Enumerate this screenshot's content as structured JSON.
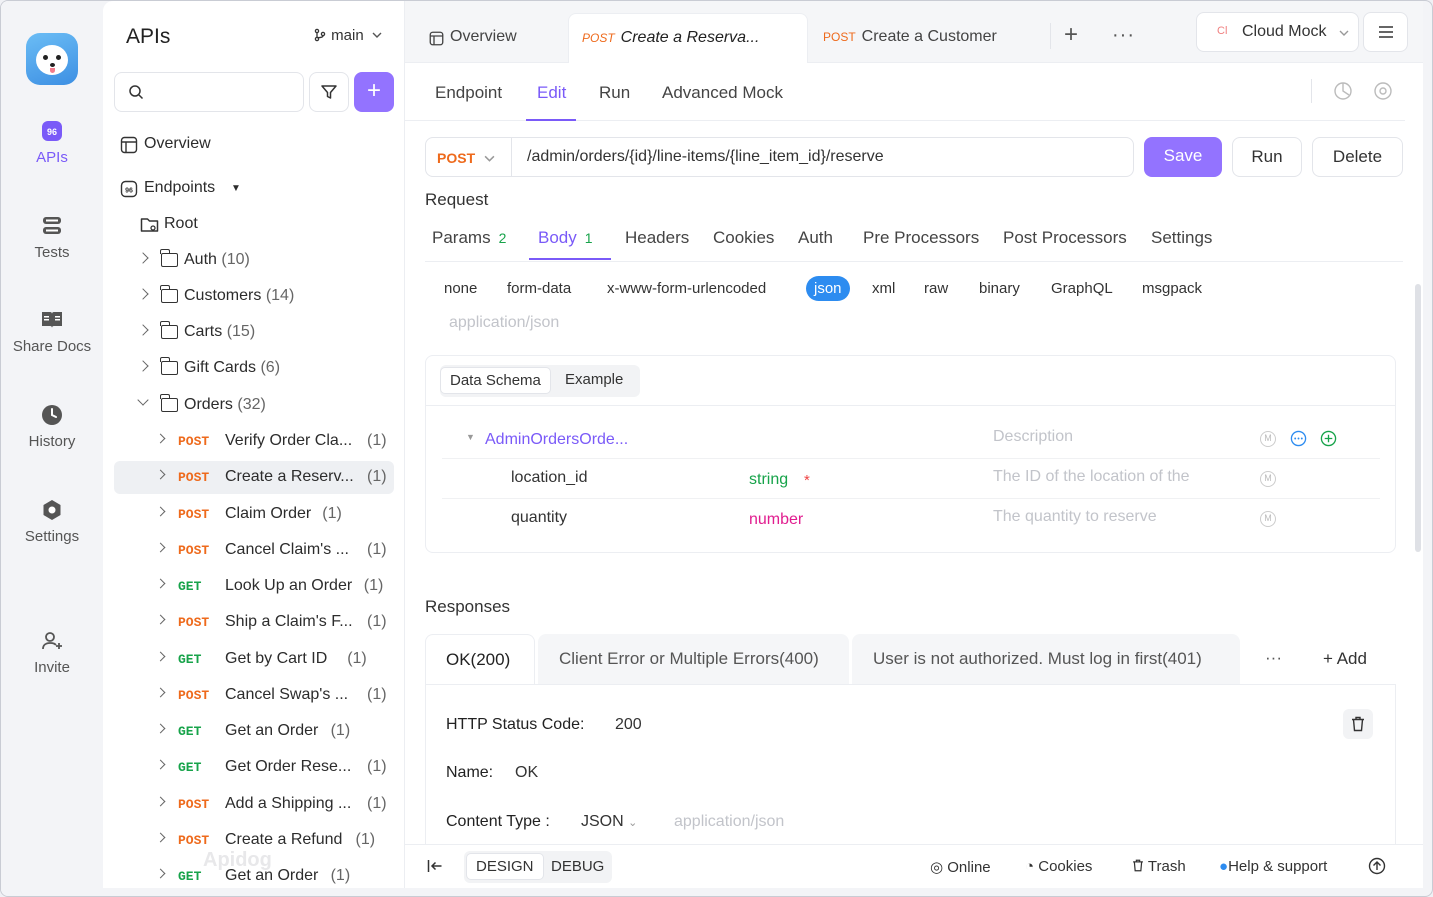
{
  "rail": {
    "items": [
      {
        "label": "APIs",
        "icon": "apis-icon"
      },
      {
        "label": "Tests",
        "icon": "tests-icon"
      },
      {
        "label": "Share Docs",
        "icon": "share-docs-icon"
      },
      {
        "label": "History",
        "icon": "history-icon"
      },
      {
        "label": "Settings",
        "icon": "settings-icon"
      },
      {
        "label": "Invite",
        "icon": "invite-icon"
      }
    ]
  },
  "sidebar": {
    "title": "APIs",
    "branch": "main",
    "overview": "Overview",
    "endpoints": "Endpoints",
    "root": "Root",
    "folders": [
      {
        "name": "Auth",
        "count": "(10)"
      },
      {
        "name": "Customers",
        "count": "(14)"
      },
      {
        "name": "Carts",
        "count": "(15)"
      },
      {
        "name": "Gift Cards",
        "count": "(6)"
      },
      {
        "name": "Orders",
        "count": "(32)"
      }
    ],
    "endpoints_list": [
      {
        "method": "POST",
        "name": "Verify Order Cla...",
        "count": "(1)"
      },
      {
        "method": "POST",
        "name": "Create a Reserv...",
        "count": "(1)"
      },
      {
        "method": "POST",
        "name": "Claim Order",
        "count": "(1)"
      },
      {
        "method": "POST",
        "name": "Cancel Claim's ...",
        "count": "(1)"
      },
      {
        "method": "GET",
        "name": "Look Up an Order",
        "count": "(1)"
      },
      {
        "method": "POST",
        "name": "Ship a Claim's F...",
        "count": "(1)"
      },
      {
        "method": "GET",
        "name": "Get by Cart ID",
        "count": "(1)"
      },
      {
        "method": "POST",
        "name": "Cancel Swap's ...",
        "count": "(1)"
      },
      {
        "method": "GET",
        "name": "Get an Order",
        "count": "(1)"
      },
      {
        "method": "GET",
        "name": "Get Order Rese...",
        "count": "(1)"
      },
      {
        "method": "POST",
        "name": "Add a Shipping ...",
        "count": "(1)"
      },
      {
        "method": "POST",
        "name": "Create a Refund",
        "count": "(1)"
      },
      {
        "method": "GET",
        "name": "Get an Order",
        "count": "(1)"
      }
    ],
    "watermark": "Apidog"
  },
  "tabs": {
    "overview": "Overview",
    "tab1_method": "POST",
    "tab1_title": "Create a Reserva...",
    "tab2_method": "POST",
    "tab2_title": "Create a Customer",
    "env_badge": "Cl",
    "env": "Cloud Mock"
  },
  "subtabs": [
    "Endpoint",
    "Edit",
    "Run",
    "Advanced Mock"
  ],
  "request": {
    "method": "POST",
    "path": "/admin/orders/{id}/line-items/{line_item_id}/reserve",
    "save": "Save",
    "run": "Run",
    "delete": "Delete",
    "section": "Request",
    "tabs": [
      {
        "label": "Params",
        "count": "2"
      },
      {
        "label": "Body",
        "count": "1"
      },
      {
        "label": "Headers",
        "count": ""
      },
      {
        "label": "Cookies",
        "count": ""
      },
      {
        "label": "Auth",
        "count": ""
      },
      {
        "label": "Pre Processors",
        "count": ""
      },
      {
        "label": "Post Processors",
        "count": ""
      },
      {
        "label": "Settings",
        "count": ""
      }
    ],
    "body_types": [
      "none",
      "form-data",
      "x-www-form-urlencoded",
      "json",
      "xml",
      "raw",
      "binary",
      "GraphQL",
      "msgpack"
    ],
    "content_type_hint": "application/json",
    "schema_tabs": [
      "Data Schema",
      "Example"
    ],
    "schema": {
      "root": "AdminOrdersOrde...",
      "desc_placeholder": "Description",
      "fields": [
        {
          "name": "location_id",
          "type": "string",
          "required": "*",
          "desc": "The ID of the location of the"
        },
        {
          "name": "quantity",
          "type": "number",
          "required": "",
          "desc": "The quantity to reserve"
        }
      ]
    }
  },
  "responses": {
    "section": "Responses",
    "tabs": [
      "OK(200)",
      "Client Error or Multiple Errors(400)",
      "User is not authorized. Must log in first(401)"
    ],
    "more": "···",
    "add": "Add",
    "status_label": "HTTP Status Code:",
    "status_value": "200",
    "name_label": "Name:",
    "name_value": "OK",
    "ctype_label": "Content Type :",
    "ctype_value": "JSON",
    "ctype_hint": "application/json"
  },
  "footer": {
    "design": "DESIGN",
    "debug": "DEBUG",
    "online": "Online",
    "cookies": "Cookies",
    "trash": "Trash",
    "help": "Help & support"
  },
  "colors": {
    "accent": "#7a5af8",
    "post": "#ee6a1c",
    "get": "#17a34a",
    "json_pill": "#2d8cf0"
  }
}
